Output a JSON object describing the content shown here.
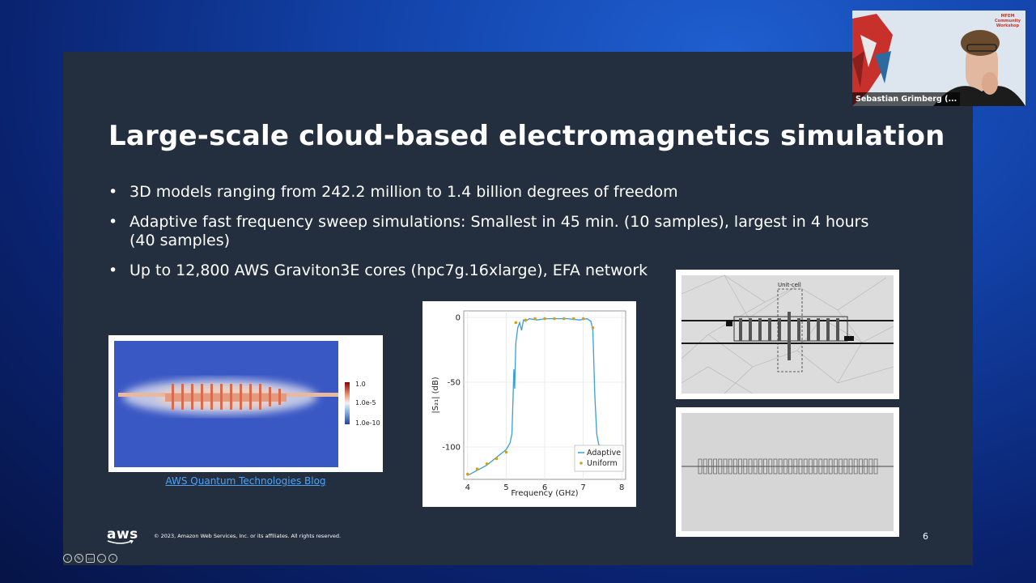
{
  "slide": {
    "title": "Large-scale cloud-based electromagnetics simulation",
    "bullets": [
      "3D models ranging from 242.2 million to 1.4 billion degrees of freedom",
      "Adaptive fast frequency sweep simulations: Smallest in 45 min. (10 samples), largest in 4 hours (40 samples)",
      "Up to 12,800 AWS Graviton3E cores (hpc7g.16xlarge), EFA network"
    ],
    "bullet_char": "•",
    "blog_link": "AWS Quantum Technologies Blog",
    "copyright": "© 2023, Amazon Web Services, Inc. or its affiliates. All rights reserved.",
    "page_number": "6",
    "logo_text": "aws",
    "colorbar_labels": [
      "1.0",
      "1.0e-5",
      "1.0e-10"
    ],
    "mesh_label": "Unit-cell"
  },
  "webcam": {
    "name": "Sebastian Grimberg (...",
    "workshop_lines": [
      "MFEM",
      "Community",
      "Workshop"
    ]
  },
  "controls": [
    "prev-icon",
    "pen-icon",
    "captions-icon",
    "more-icon",
    "next-icon"
  ],
  "colors": {
    "slide_bg": "#232f3e",
    "link": "#4aa3ff",
    "adaptive_line": "#3a9fd8",
    "uniform_marker": "#d4a017"
  },
  "chart_data": {
    "type": "line",
    "title": "",
    "xlabel": "Frequency (GHz)",
    "ylabel": "|S₂₁| (dB)",
    "xlim": [
      3.9,
      8.1
    ],
    "ylim": [
      -125,
      5
    ],
    "xticks": [
      4,
      5,
      6,
      7,
      8
    ],
    "yticks": [
      0,
      -50,
      -100
    ],
    "legend_position": "bottom-right",
    "grid": true,
    "series": [
      {
        "name": "Adaptive",
        "style": "line",
        "x": [
          4.0,
          4.5,
          5.0,
          5.1,
          5.15,
          5.18,
          5.2,
          5.22,
          5.25,
          5.3,
          5.35,
          5.4,
          5.45,
          5.5,
          5.6,
          5.8,
          6.0,
          6.3,
          6.6,
          6.9,
          7.1,
          7.2,
          7.25,
          7.3,
          7.35,
          7.4,
          7.6,
          7.8,
          8.0
        ],
        "y": [
          -122,
          -114,
          -102,
          -97,
          -90,
          -60,
          -40,
          -55,
          -20,
          -8,
          -4,
          -10,
          -2,
          -3,
          -1,
          -2,
          -1,
          -1,
          -1,
          -2,
          -1,
          -3,
          -10,
          -60,
          -90,
          -98,
          -104,
          -108,
          -111
        ]
      },
      {
        "name": "Uniform",
        "style": "markers",
        "x": [
          4.0,
          4.25,
          4.5,
          4.75,
          5.0,
          5.25,
          5.5,
          5.75,
          6.0,
          6.25,
          6.5,
          6.75,
          7.0,
          7.25,
          7.5,
          7.75,
          8.0
        ],
        "y": [
          -121,
          -117,
          -113,
          -109,
          -104,
          -4,
          -2,
          -1,
          -1,
          -1,
          -1,
          -1,
          -1,
          -8,
          -102,
          -107,
          -112
        ]
      }
    ]
  }
}
